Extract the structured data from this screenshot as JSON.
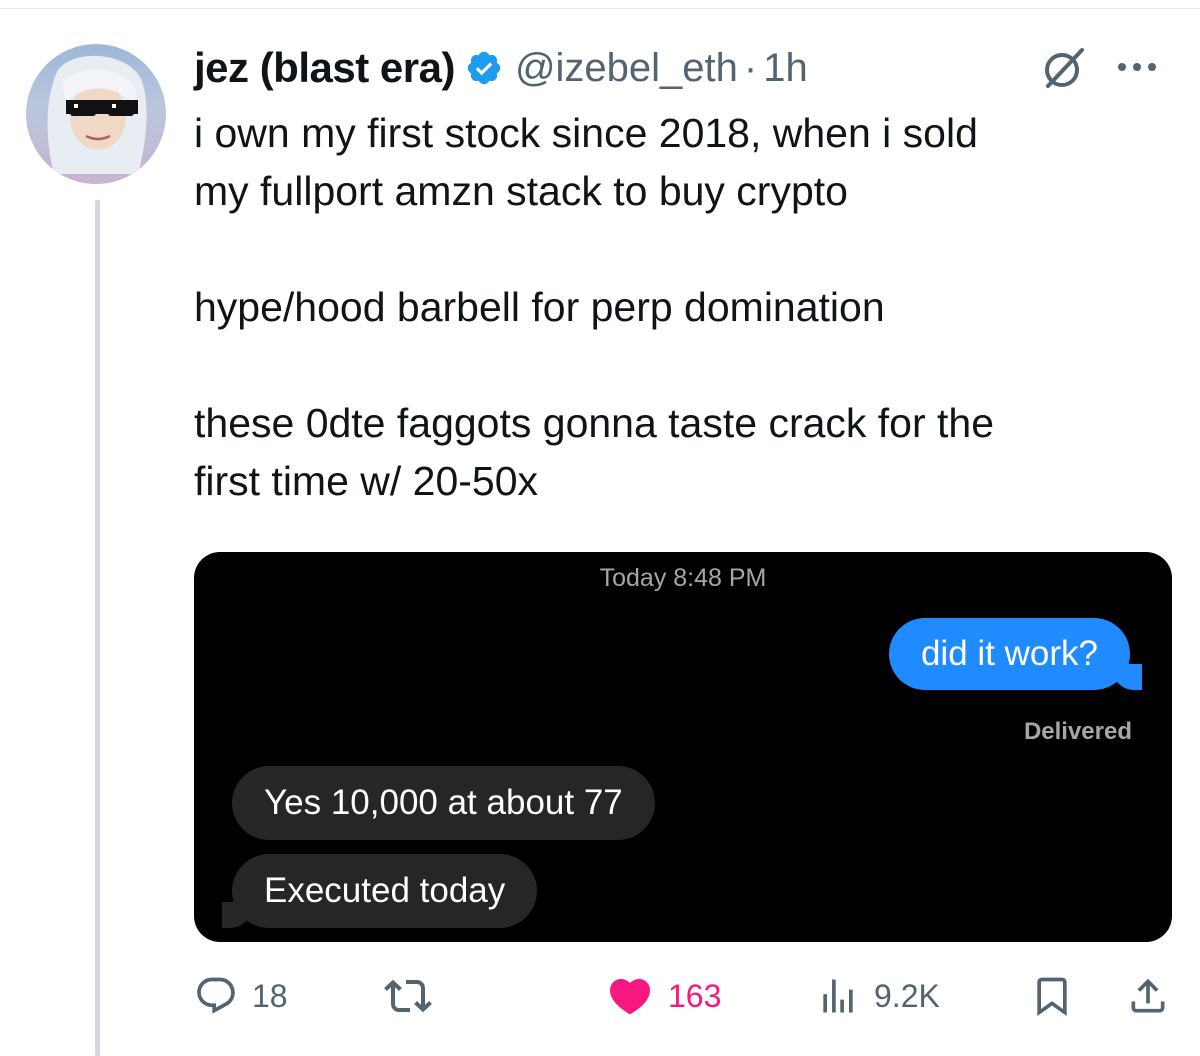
{
  "tweet": {
    "author": {
      "name": "jez (blast era)",
      "handle": "@izebel_eth",
      "separator": "·",
      "time": "1h",
      "verified": true,
      "verified_color": "#1d9bf0",
      "avatar_icon": "avatar-image"
    },
    "text": {
      "line1": "i own my first stock since 2018, when i sold",
      "line2": "my fullport amzn stack to buy crypto",
      "line3": "hype/hood barbell for perp domination",
      "line4": "these 0dte faggots gonna taste crack for the",
      "line5": "first time w/ 20-50x"
    },
    "media": {
      "timestamp": "Today 8:48 PM",
      "outgoing_message": "did it work?",
      "status": "Delivered",
      "incoming_messages": [
        "Yes 10,000 at about 77",
        "Executed today"
      ],
      "outgoing_color": "#1f8bff",
      "incoming_color": "#262628"
    },
    "actions": {
      "replies": "18",
      "likes": "163",
      "views": "9.2K",
      "like_color": "#f91880",
      "icons": [
        "reply-icon",
        "retweet-icon",
        "heart-icon",
        "views-icon",
        "bookmark-icon",
        "share-icon",
        "grok-icon",
        "more-icon"
      ]
    }
  }
}
